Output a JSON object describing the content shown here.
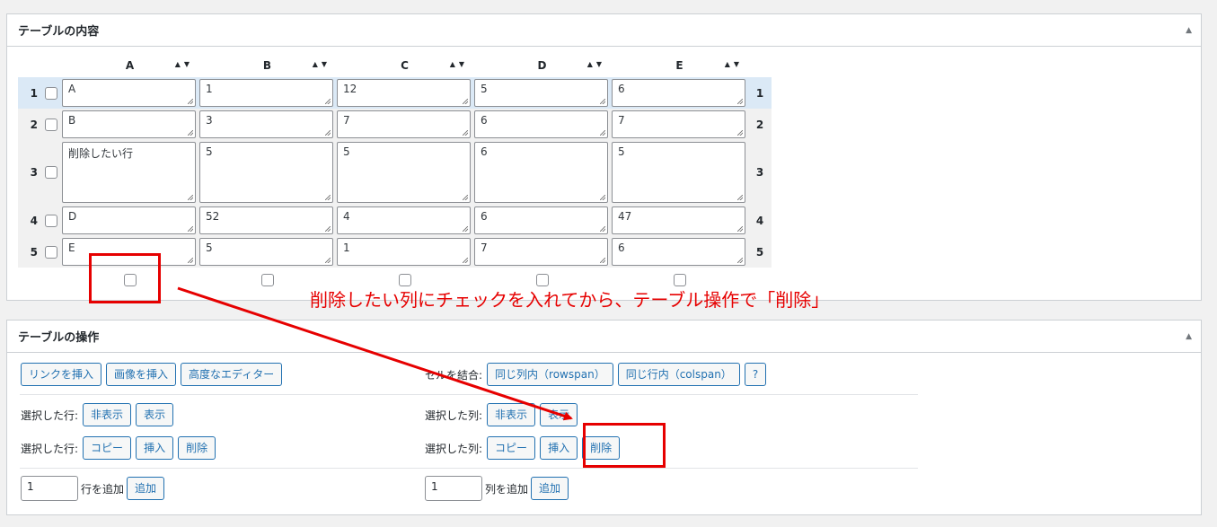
{
  "table_box": {
    "title": "テーブルの内容",
    "columns": [
      "A",
      "B",
      "C",
      "D",
      "E"
    ],
    "rows": [
      {
        "num": "1",
        "cells": [
          "A",
          "1",
          "12",
          "5",
          "6"
        ]
      },
      {
        "num": "2",
        "cells": [
          "B",
          "3",
          "7",
          "6",
          "7"
        ]
      },
      {
        "num": "3",
        "cells": [
          "削除したい行",
          "5",
          "5",
          "6",
          "5"
        ]
      },
      {
        "num": "4",
        "cells": [
          "D",
          "52",
          "4",
          "6",
          "47"
        ]
      },
      {
        "num": "5",
        "cells": [
          "E",
          "5",
          "1",
          "7",
          "6"
        ]
      }
    ],
    "sort_icons": "▲▼"
  },
  "annotation": {
    "text": "削除したい列にチェックを入れてから、テーブル操作で「削除」",
    "color": "#e60000"
  },
  "ops_box": {
    "title": "テーブルの操作",
    "insert_link": "リンクを挿入",
    "insert_image": "画像を挿入",
    "advanced_editor": "高度なエディター",
    "merge_label": "セルを結合:",
    "merge_rowspan": "同じ列内（rowspan）",
    "merge_colspan": "同じ行内（colspan）",
    "help": "?",
    "row_selected_label": "選択した行:",
    "col_selected_label": "選択した列:",
    "hide": "非表示",
    "show": "表示",
    "copy": "コピー",
    "insert": "挿入",
    "delete": "削除",
    "add_rows_value": "1",
    "add_rows_label": "行を追加",
    "add_cols_value": "1",
    "add_cols_label": "列を追加",
    "add": "追加"
  }
}
